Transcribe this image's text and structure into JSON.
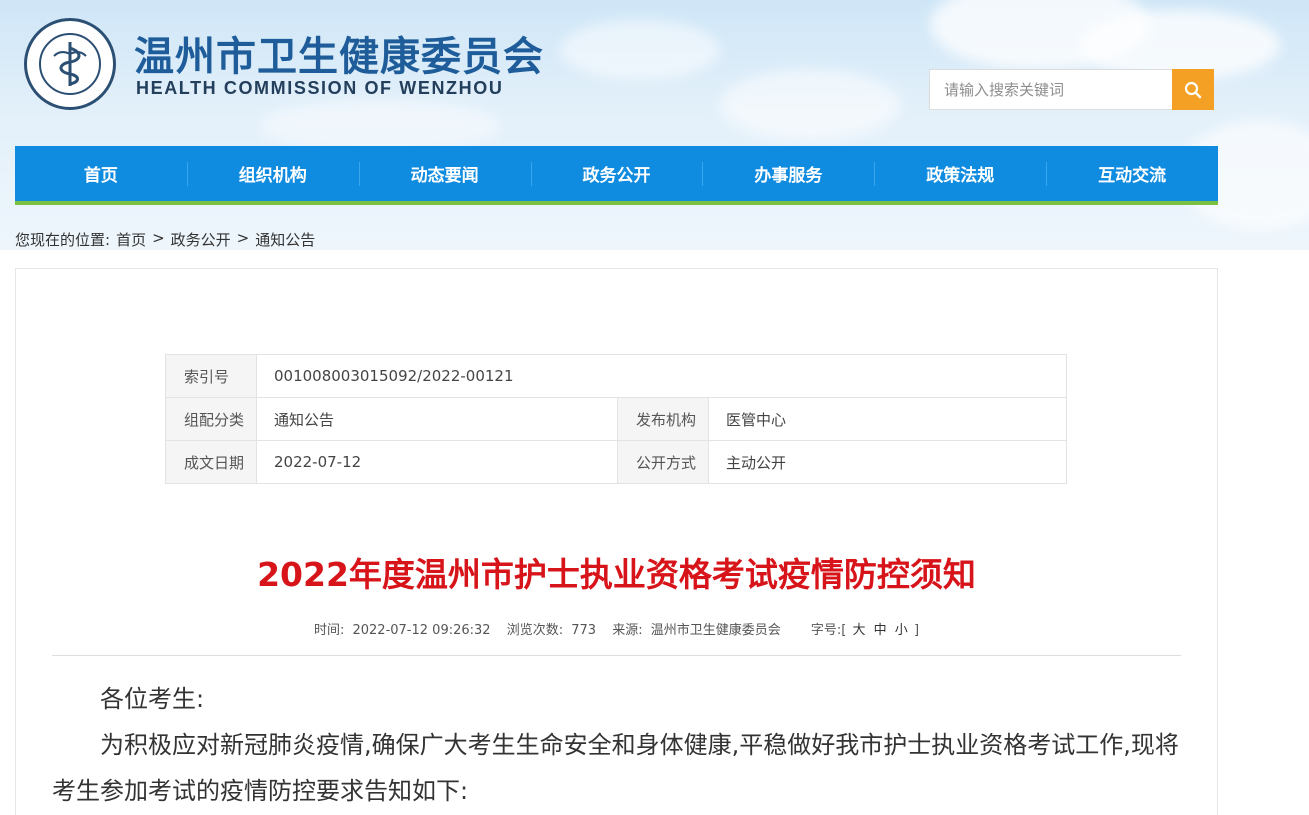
{
  "site": {
    "title_cn": "温州市卫生健康委员会",
    "title_en": "HEALTH COMMISSION OF WENZHOU",
    "logo_icon": "caduceus-emblem-icon"
  },
  "search": {
    "placeholder": "请输入搜索关键词",
    "button_icon": "search-icon"
  },
  "nav": {
    "items": [
      "首页",
      "组织机构",
      "动态要闻",
      "政务公开",
      "办事服务",
      "政策法规",
      "互动交流"
    ]
  },
  "breadcrumb": {
    "prefix": "您现在的位置:",
    "items": [
      "首页",
      "政务公开",
      "通知公告"
    ],
    "separator": ">"
  },
  "meta": {
    "index_label": "索引号",
    "index_value": "001008003015092/2022-00121",
    "category_label": "组配分类",
    "category_value": "通知公告",
    "publisher_label": "发布机构",
    "publisher_value": "医管中心",
    "date_label": "成文日期",
    "date_value": "2022-07-12",
    "public_label": "公开方式",
    "public_value": "主动公开"
  },
  "article": {
    "title": "2022年度温州市护士执业资格考试疫情防控须知",
    "time_label": "时间:",
    "time_value": "2022-07-12 09:26:32",
    "views_label": "浏览次数:",
    "views_value": "773",
    "source_label": "来源:",
    "source_value": "温州市卫生健康委员会",
    "font_label": "字号:[",
    "font_large": "大",
    "font_medium": "中",
    "font_small": "小",
    "font_close": "]",
    "paragraphs": [
      "各位考生:",
      "为积极应对新冠肺炎疫情,确保广大考生生命安全和身体健康,平稳做好我市护士执业资格考试工作,现将考生参加考试的疫情防控要求告知如下:"
    ]
  },
  "colors": {
    "nav_bg": "#0f8be0",
    "nav_border": "#7ac143",
    "search_btn": "#f3a024",
    "title_red": "#d7141a",
    "brand_blue": "#1f5d9a"
  }
}
